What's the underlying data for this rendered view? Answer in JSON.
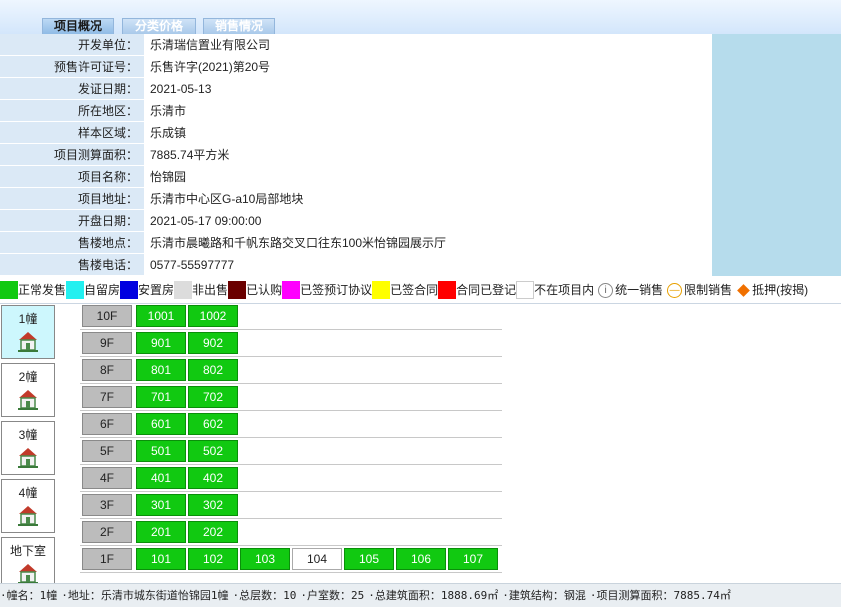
{
  "tabs": [
    "项目概况",
    "分类价格",
    "销售情况"
  ],
  "info": [
    {
      "label": "开发单位：",
      "value": "乐清瑞信置业有限公司"
    },
    {
      "label": "预售许可证号：",
      "value": "乐售许字(2021)第20号"
    },
    {
      "label": "发证日期：",
      "value": "2021-05-13"
    },
    {
      "label": "所在地区：",
      "value": "乐清市"
    },
    {
      "label": "样本区域：",
      "value": "乐成镇"
    },
    {
      "label": "项目测算面积：",
      "value": "7885.74平方米"
    },
    {
      "label": "项目名称：",
      "value": "怡锦园"
    },
    {
      "label": "项目地址：",
      "value": "乐清市中心区G-a10局部地块"
    },
    {
      "label": "开盘日期：",
      "value": "2021-05-17 09:00:00"
    },
    {
      "label": "售楼地点：",
      "value": "乐清市晨曦路和千帆东路交叉口往东100米怡锦园展示厅"
    },
    {
      "label": "售楼电话：",
      "value": "0577-55597777"
    }
  ],
  "legend": [
    {
      "label": "正常发售",
      "color": "#11c911"
    },
    {
      "label": "自留房",
      "color": "#22f0f0"
    },
    {
      "label": "安置房",
      "color": "#0000e0"
    },
    {
      "label": "非出售",
      "color": "#dcdcdc"
    },
    {
      "label": "已认购",
      "color": "#6a0000"
    },
    {
      "label": "已签预订协议",
      "color": "#ff00ff"
    },
    {
      "label": "已签合同",
      "color": "#ffff00"
    },
    {
      "label": "合同已登记",
      "color": "#ff0000"
    },
    {
      "label": "不在项目内",
      "color": "#ffffff"
    }
  ],
  "legend_icons": [
    {
      "label": "统一销售",
      "icon": "info-circle-icon",
      "glyph": "i"
    },
    {
      "label": "限制销售",
      "icon": "restricted-circle-icon",
      "glyph": "—"
    },
    {
      "label": "抵押(按揭)",
      "icon": "diamond-icon",
      "glyph": ""
    }
  ],
  "buildings": [
    {
      "name": "1幢",
      "active": true
    },
    {
      "name": "2幢",
      "active": false
    },
    {
      "name": "3幢",
      "active": false
    },
    {
      "name": "4幢",
      "active": false
    },
    {
      "name": "地下室",
      "active": false
    }
  ],
  "floors": [
    {
      "floor": "10F",
      "units": [
        {
          "no": "1001",
          "status": "正常发售"
        },
        {
          "no": "1002",
          "status": "正常发售"
        }
      ]
    },
    {
      "floor": "9F",
      "units": [
        {
          "no": "901",
          "status": "正常发售"
        },
        {
          "no": "902",
          "status": "正常发售"
        }
      ]
    },
    {
      "floor": "8F",
      "units": [
        {
          "no": "801",
          "status": "正常发售"
        },
        {
          "no": "802",
          "status": "正常发售"
        }
      ]
    },
    {
      "floor": "7F",
      "units": [
        {
          "no": "701",
          "status": "正常发售"
        },
        {
          "no": "702",
          "status": "正常发售"
        }
      ]
    },
    {
      "floor": "6F",
      "units": [
        {
          "no": "601",
          "status": "正常发售"
        },
        {
          "no": "602",
          "status": "正常发售"
        }
      ]
    },
    {
      "floor": "5F",
      "units": [
        {
          "no": "501",
          "status": "正常发售"
        },
        {
          "no": "502",
          "status": "正常发售"
        }
      ]
    },
    {
      "floor": "4F",
      "units": [
        {
          "no": "401",
          "status": "正常发售"
        },
        {
          "no": "402",
          "status": "正常发售"
        }
      ]
    },
    {
      "floor": "3F",
      "units": [
        {
          "no": "301",
          "status": "正常发售"
        },
        {
          "no": "302",
          "status": "正常发售"
        }
      ]
    },
    {
      "floor": "2F",
      "units": [
        {
          "no": "201",
          "status": "正常发售"
        },
        {
          "no": "202",
          "status": "正常发售"
        }
      ]
    },
    {
      "floor": "1F",
      "units": [
        {
          "no": "101",
          "status": "正常发售"
        },
        {
          "no": "102",
          "status": "正常发售"
        },
        {
          "no": "103",
          "status": "正常发售"
        },
        {
          "no": "104",
          "status": "不在项目内"
        },
        {
          "no": "105",
          "status": "正常发售"
        },
        {
          "no": "106",
          "status": "正常发售"
        },
        {
          "no": "107",
          "status": "正常发售"
        }
      ]
    }
  ],
  "footer": [
    "·幢名：1幢",
    "·地址：乐清市城东街道怡锦园1幢",
    "·总层数：10",
    "·户室数：25",
    "·总建筑面积：1888.69㎡",
    "·建筑结构：钢混",
    "·项目测算面积：7885.74㎡"
  ]
}
